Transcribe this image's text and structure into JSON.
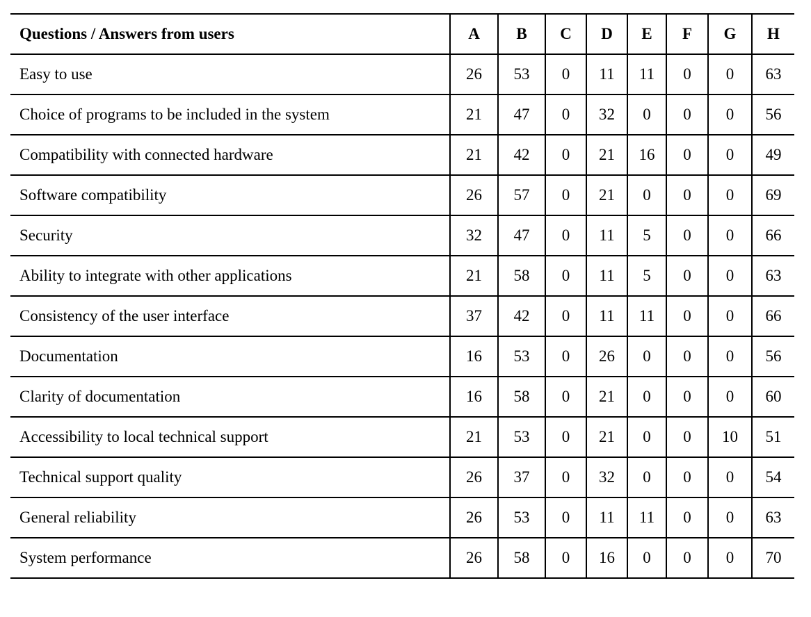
{
  "table": {
    "header": {
      "question_label": "Questions / Answers from users",
      "columns": [
        "A",
        "B",
        "C",
        "D",
        "E",
        "F",
        "G",
        "H"
      ]
    },
    "rows": [
      {
        "question": "Easy to use",
        "values": [
          "26",
          "53",
          "0",
          "11",
          "11",
          "0",
          "0",
          "63"
        ]
      },
      {
        "question": "Choice of programs to be included in the system",
        "values": [
          "21",
          "47",
          "0",
          "32",
          "0",
          "0",
          "0",
          "56"
        ]
      },
      {
        "question": "Compatibility with connected hardware",
        "values": [
          "21",
          "42",
          "0",
          "21",
          "16",
          "0",
          "0",
          "49"
        ]
      },
      {
        "question": "Software compatibility",
        "values": [
          "26",
          "57",
          "0",
          "21",
          "0",
          "0",
          "0",
          "69"
        ]
      },
      {
        "question": "Security",
        "values": [
          "32",
          "47",
          "0",
          "11",
          "5",
          "0",
          "0",
          "66"
        ]
      },
      {
        "question": "Ability to integrate with other applications",
        "values": [
          "21",
          "58",
          "0",
          "11",
          "5",
          "0",
          "0",
          "63"
        ]
      },
      {
        "question": "Consistency of the user interface",
        "values": [
          "37",
          "42",
          "0",
          "11",
          "11",
          "0",
          "0",
          "66"
        ]
      },
      {
        "question": "Documentation",
        "values": [
          "16",
          "53",
          "0",
          "26",
          "0",
          "0",
          "0",
          "56"
        ]
      },
      {
        "question": "Clarity of documentation",
        "values": [
          "16",
          "58",
          "0",
          "21",
          "0",
          "0",
          "0",
          "60"
        ]
      },
      {
        "question": "Accessibility to local technical support",
        "values": [
          "21",
          "53",
          "0",
          "21",
          "0",
          "0",
          "10",
          "51"
        ]
      },
      {
        "question": "Technical support quality",
        "values": [
          "26",
          "37",
          "0",
          "32",
          "0",
          "0",
          "0",
          "54"
        ]
      },
      {
        "question": "General reliability",
        "values": [
          "26",
          "53",
          "0",
          "11",
          "11",
          "0",
          "0",
          "63"
        ]
      },
      {
        "question": "System performance",
        "values": [
          "26",
          "58",
          "0",
          "16",
          "0",
          "0",
          "0",
          "70"
        ]
      }
    ]
  }
}
